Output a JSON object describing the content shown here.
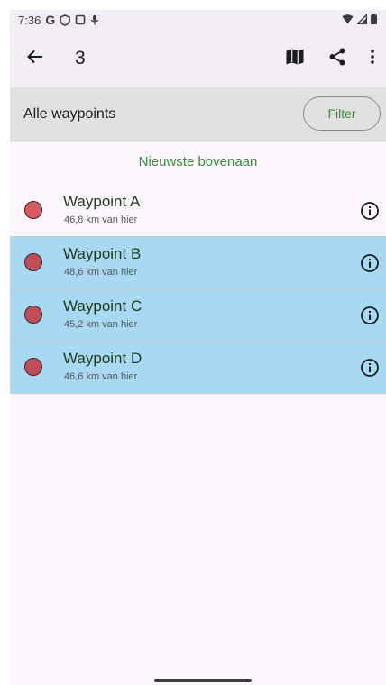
{
  "status_bar": {
    "time": "7:36",
    "google_label": "G"
  },
  "app_bar": {
    "title": "3"
  },
  "filter_bar": {
    "label": "Alle waypoints",
    "filter_button": "Filter"
  },
  "sort_label": "Nieuwste bovenaan",
  "waypoints": [
    {
      "name": "Waypoint A",
      "distance": "46,8 km van hier",
      "selected": false
    },
    {
      "name": "Waypoint B",
      "distance": "48,6 km van hier",
      "selected": true
    },
    {
      "name": "Waypoint C",
      "distance": "45,2 km van hier",
      "selected": true
    },
    {
      "name": "Waypoint D",
      "distance": "46,6 km van hier",
      "selected": true
    }
  ],
  "icons": {
    "back": "arrow-back-icon",
    "map": "map-icon",
    "share": "share-icon",
    "more": "more-vert-icon",
    "info": "info-icon",
    "waypoint_marker": "waypoint-dot-icon"
  },
  "colors": {
    "accent_green": "#3a8a3a",
    "selected_row": "#a9d8f2",
    "waypoint_dot": "#d9595e"
  }
}
